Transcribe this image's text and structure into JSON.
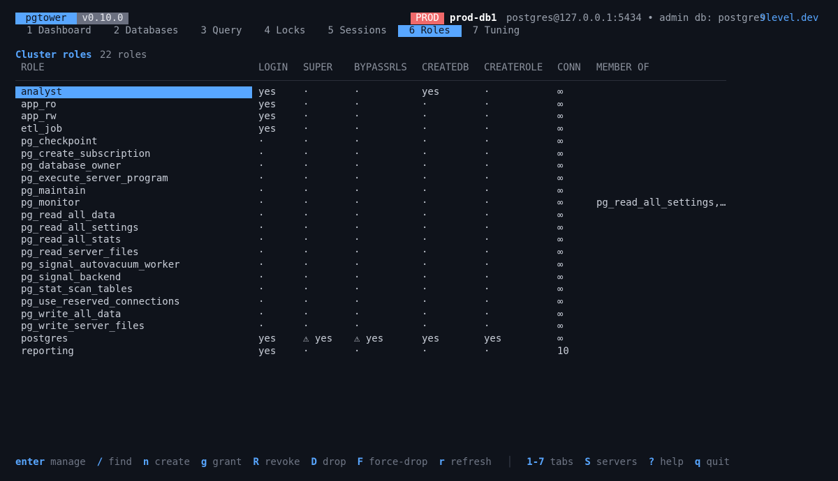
{
  "header": {
    "app_name": "pgtower",
    "version": "v0.10.0",
    "env_badge": "PROD",
    "host": "prod-db1",
    "connection": "postgres@127.0.0.1:5434 • admin db: postgres",
    "site": "9level.dev"
  },
  "tabs": [
    {
      "label": "1 Dashboard",
      "active": false
    },
    {
      "label": "2 Databases",
      "active": false
    },
    {
      "label": "3 Query",
      "active": false
    },
    {
      "label": "4 Locks",
      "active": false
    },
    {
      "label": "5 Sessions",
      "active": false
    },
    {
      "label": "6 Roles",
      "active": true
    },
    {
      "label": "7 Tuning",
      "active": false
    }
  ],
  "section": {
    "title": "Cluster roles",
    "count": "22 roles"
  },
  "columns": [
    "ROLE",
    "LOGIN",
    "SUPER",
    "BYPASSRLS",
    "CREATEDB",
    "CREATEROLE",
    "CONN",
    "MEMBER OF"
  ],
  "rows": [
    {
      "role": "analyst",
      "login": "yes",
      "super": "·",
      "bypassrls": "·",
      "createdb": "yes",
      "createrole": "·",
      "conn": "∞",
      "member_of": "",
      "selected": true
    },
    {
      "role": "app_ro",
      "login": "yes",
      "super": "·",
      "bypassrls": "·",
      "createdb": "·",
      "createrole": "·",
      "conn": "∞",
      "member_of": ""
    },
    {
      "role": "app_rw",
      "login": "yes",
      "super": "·",
      "bypassrls": "·",
      "createdb": "·",
      "createrole": "·",
      "conn": "∞",
      "member_of": ""
    },
    {
      "role": "etl_job",
      "login": "yes",
      "super": "·",
      "bypassrls": "·",
      "createdb": "·",
      "createrole": "·",
      "conn": "∞",
      "member_of": ""
    },
    {
      "role": "pg_checkpoint",
      "login": "·",
      "super": "·",
      "bypassrls": "·",
      "createdb": "·",
      "createrole": "·",
      "conn": "∞",
      "member_of": ""
    },
    {
      "role": "pg_create_subscription",
      "login": "·",
      "super": "·",
      "bypassrls": "·",
      "createdb": "·",
      "createrole": "·",
      "conn": "∞",
      "member_of": ""
    },
    {
      "role": "pg_database_owner",
      "login": "·",
      "super": "·",
      "bypassrls": "·",
      "createdb": "·",
      "createrole": "·",
      "conn": "∞",
      "member_of": ""
    },
    {
      "role": "pg_execute_server_program",
      "login": "·",
      "super": "·",
      "bypassrls": "·",
      "createdb": "·",
      "createrole": "·",
      "conn": "∞",
      "member_of": ""
    },
    {
      "role": "pg_maintain",
      "login": "·",
      "super": "·",
      "bypassrls": "·",
      "createdb": "·",
      "createrole": "·",
      "conn": "∞",
      "member_of": ""
    },
    {
      "role": "pg_monitor",
      "login": "·",
      "super": "·",
      "bypassrls": "·",
      "createdb": "·",
      "createrole": "·",
      "conn": "∞",
      "member_of": "pg_read_all_settings,…"
    },
    {
      "role": "pg_read_all_data",
      "login": "·",
      "super": "·",
      "bypassrls": "·",
      "createdb": "·",
      "createrole": "·",
      "conn": "∞",
      "member_of": ""
    },
    {
      "role": "pg_read_all_settings",
      "login": "·",
      "super": "·",
      "bypassrls": "·",
      "createdb": "·",
      "createrole": "·",
      "conn": "∞",
      "member_of": ""
    },
    {
      "role": "pg_read_all_stats",
      "login": "·",
      "super": "·",
      "bypassrls": "·",
      "createdb": "·",
      "createrole": "·",
      "conn": "∞",
      "member_of": ""
    },
    {
      "role": "pg_read_server_files",
      "login": "·",
      "super": "·",
      "bypassrls": "·",
      "createdb": "·",
      "createrole": "·",
      "conn": "∞",
      "member_of": ""
    },
    {
      "role": "pg_signal_autovacuum_worker",
      "login": "·",
      "super": "·",
      "bypassrls": "·",
      "createdb": "·",
      "createrole": "·",
      "conn": "∞",
      "member_of": ""
    },
    {
      "role": "pg_signal_backend",
      "login": "·",
      "super": "·",
      "bypassrls": "·",
      "createdb": "·",
      "createrole": "·",
      "conn": "∞",
      "member_of": ""
    },
    {
      "role": "pg_stat_scan_tables",
      "login": "·",
      "super": "·",
      "bypassrls": "·",
      "createdb": "·",
      "createrole": "·",
      "conn": "∞",
      "member_of": ""
    },
    {
      "role": "pg_use_reserved_connections",
      "login": "·",
      "super": "·",
      "bypassrls": "·",
      "createdb": "·",
      "createrole": "·",
      "conn": "∞",
      "member_of": ""
    },
    {
      "role": "pg_write_all_data",
      "login": "·",
      "super": "·",
      "bypassrls": "·",
      "createdb": "·",
      "createrole": "·",
      "conn": "∞",
      "member_of": ""
    },
    {
      "role": "pg_write_server_files",
      "login": "·",
      "super": "·",
      "bypassrls": "·",
      "createdb": "·",
      "createrole": "·",
      "conn": "∞",
      "member_of": ""
    },
    {
      "role": "postgres",
      "login": "yes",
      "super": "⚠ yes",
      "bypassrls": "⚠ yes",
      "createdb": "yes",
      "createrole": "yes",
      "conn": "∞",
      "member_of": ""
    },
    {
      "role": "reporting",
      "login": "yes",
      "super": "·",
      "bypassrls": "·",
      "createdb": "·",
      "createrole": "·",
      "conn": "10",
      "member_of": ""
    }
  ],
  "footer": [
    {
      "key": "enter",
      "desc": "manage"
    },
    {
      "key": "/",
      "desc": "find"
    },
    {
      "key": "n",
      "desc": "create"
    },
    {
      "key": "g",
      "desc": "grant"
    },
    {
      "key": "R",
      "desc": "revoke"
    },
    {
      "key": "D",
      "desc": "drop"
    },
    {
      "key": "F",
      "desc": "force-drop"
    },
    {
      "key": "r",
      "desc": "refresh"
    },
    {
      "sep": "│"
    },
    {
      "key": "1-7",
      "desc": "tabs"
    },
    {
      "key": "S",
      "desc": "servers"
    },
    {
      "key": "?",
      "desc": "help"
    },
    {
      "key": "q",
      "desc": "quit"
    }
  ],
  "colors": {
    "background": "#0f131b",
    "accent": "#58a6ff",
    "prod_badge": "#f0696a",
    "version_badge": "#6b7080"
  }
}
